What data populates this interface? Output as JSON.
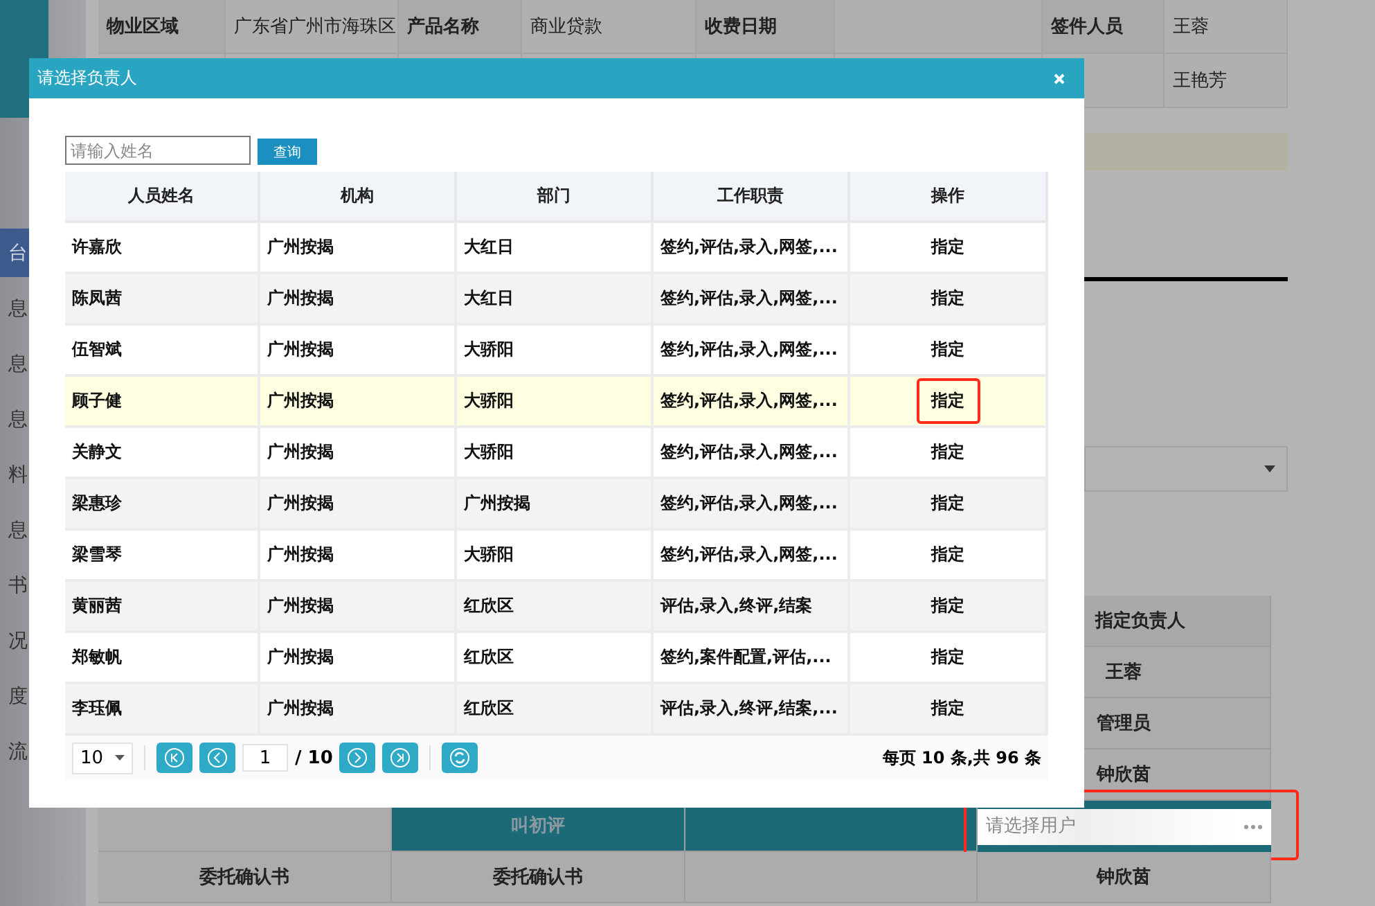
{
  "page": {
    "info_table": {
      "cells": [
        "物业区域",
        "广东省广州市海珠区",
        "产品名称",
        "商业贷款",
        "收费日期",
        "",
        "签件人员",
        "王蓉"
      ],
      "second_row_last": "王艳芳"
    },
    "sidebar": {
      "items": [
        {
          "label": "台",
          "selected": true
        },
        {
          "label": "息",
          "selected": false
        },
        {
          "label": "息",
          "selected": false
        },
        {
          "label": "息",
          "selected": false
        },
        {
          "label": "料",
          "selected": false
        },
        {
          "label": "息",
          "selected": false
        },
        {
          "label": "书",
          "selected": false
        },
        {
          "label": "况",
          "selected": false
        },
        {
          "label": "度",
          "selected": false
        },
        {
          "label": "流",
          "selected": false
        }
      ]
    },
    "assignee_column": {
      "header": "指定负责人",
      "values": [
        "王蓉",
        "管理员",
        "钟欣茵"
      ],
      "field": {
        "placeholder": "请选择用户",
        "marked": true
      },
      "after": "钟欣茵"
    },
    "step_row": {
      "label": "叫初评"
    },
    "doc_row": {
      "cells": [
        "委托确认书",
        "委托确认书"
      ]
    }
  },
  "dialog": {
    "title": "请选择负责人",
    "search": {
      "placeholder": "请输入姓名"
    },
    "search_button": "查询",
    "columns": [
      "人员姓名",
      "机构",
      "部门",
      "工作职责",
      "操作"
    ],
    "rows": [
      {
        "name": "许嘉欣",
        "org": "广州按揭",
        "dept": "大红日",
        "duty": "签约,评估,录入,网签,...",
        "action": "指定",
        "highlighted": false,
        "marked": false
      },
      {
        "name": "陈凤茜",
        "org": "广州按揭",
        "dept": "大红日",
        "duty": "签约,评估,录入,网签,...",
        "action": "指定",
        "highlighted": false,
        "marked": false
      },
      {
        "name": "伍智斌",
        "org": "广州按揭",
        "dept": "大骄阳",
        "duty": "签约,评估,录入,网签,...",
        "action": "指定",
        "highlighted": false,
        "marked": false
      },
      {
        "name": "顾子健",
        "org": "广州按揭",
        "dept": "大骄阳",
        "duty": "签约,评估,录入,网签,...",
        "action": "指定",
        "highlighted": true,
        "marked": true
      },
      {
        "name": "关静文",
        "org": "广州按揭",
        "dept": "大骄阳",
        "duty": "签约,评估,录入,网签,...",
        "action": "指定",
        "highlighted": false,
        "marked": false
      },
      {
        "name": "梁惠珍",
        "org": "广州按揭",
        "dept": "广州按揭",
        "duty": "签约,评估,录入,网签,...",
        "action": "指定",
        "highlighted": false,
        "marked": false
      },
      {
        "name": "梁雪琴",
        "org": "广州按揭",
        "dept": "大骄阳",
        "duty": "签约,评估,录入,网签,...",
        "action": "指定",
        "highlighted": false,
        "marked": false
      },
      {
        "name": "黄丽茜",
        "org": "广州按揭",
        "dept": "红欣区",
        "duty": "评估,录入,终评,结案",
        "action": "指定",
        "highlighted": false,
        "marked": false
      },
      {
        "name": "郑敏帆",
        "org": "广州按揭",
        "dept": "红欣区",
        "duty": "签约,案件配置,评估,...",
        "action": "指定",
        "highlighted": false,
        "marked": false
      },
      {
        "name": "李珏佩",
        "org": "广州按揭",
        "dept": "红欣区",
        "duty": "评估,录入,终评,结案,...",
        "action": "指定",
        "highlighted": false,
        "marked": false
      }
    ],
    "pager": {
      "page_size": "10",
      "page": "1",
      "total_pages": "/ 10",
      "summary": "每页 10 条,共 96 条"
    }
  }
}
